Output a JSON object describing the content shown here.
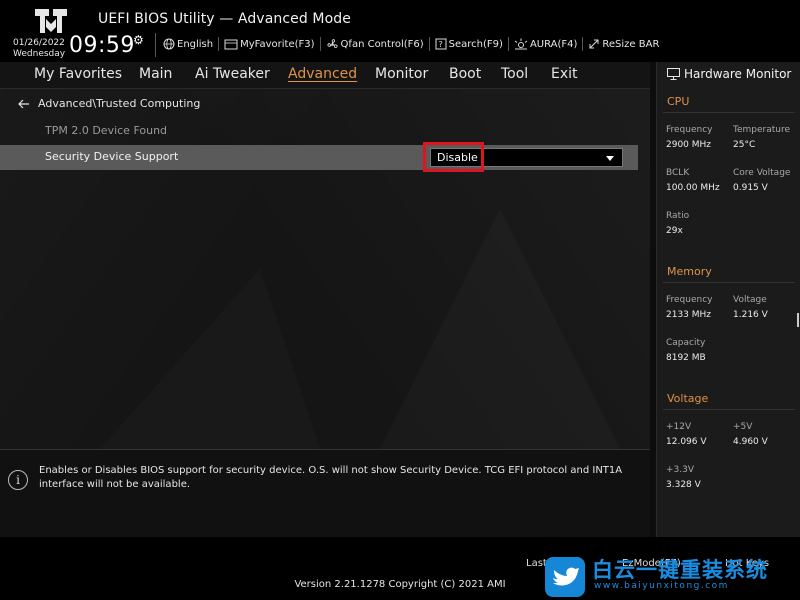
{
  "header": {
    "title": "UEFI BIOS Utility — Advanced Mode",
    "date": "01/26/2022",
    "day": "Wednesday",
    "time": "09:59",
    "toolbar": [
      {
        "icon": "globe-icon",
        "label": "English"
      },
      {
        "icon": "favorite-icon",
        "label": "MyFavorite(F3)"
      },
      {
        "icon": "fan-icon",
        "label": "Qfan Control(F6)"
      },
      {
        "icon": "search-icon",
        "label": "Search(F9)"
      },
      {
        "icon": "aura-icon",
        "label": "AURA(F4)"
      },
      {
        "icon": "resize-icon",
        "label": "ReSize BAR"
      }
    ]
  },
  "menu": {
    "items": [
      "My Favorites",
      "Main",
      "Ai Tweaker",
      "Advanced",
      "Monitor",
      "Boot",
      "Tool",
      "Exit"
    ],
    "active": "Advanced"
  },
  "main": {
    "breadcrumb": "Advanced\\Trusted Computing",
    "tpm_label": "TPM 2.0 Device Found",
    "security_label": "Security Device Support",
    "security_value": "Disable"
  },
  "help": {
    "text": "Enables or Disables BIOS support for security device. O.S. will not show Security Device. TCG EFI protocol and INT1A interface will not be available."
  },
  "hw_monitor": {
    "title": "Hardware Monitor",
    "cpu": {
      "heading": "CPU",
      "frequency_label": "Frequency",
      "frequency_value": "2900 MHz",
      "temperature_label": "Temperature",
      "temperature_value": "25°C",
      "bclk_label": "BCLK",
      "bclk_value": "100.00 MHz",
      "core_voltage_label": "Core Voltage",
      "core_voltage_value": "0.915 V",
      "ratio_label": "Ratio",
      "ratio_value": "29x"
    },
    "memory": {
      "heading": "Memory",
      "frequency_label": "Frequency",
      "frequency_value": "2133 MHz",
      "voltage_label": "Voltage",
      "voltage_value": "1.216 V",
      "capacity_label": "Capacity",
      "capacity_value": "8192 MB"
    },
    "voltage": {
      "heading": "Voltage",
      "v12_label": "+12V",
      "v12_value": "12.096 V",
      "v5_label": "+5V",
      "v5_value": "4.960 V",
      "v33_label": "+3.3V",
      "v33_value": "3.328 V"
    }
  },
  "footer": {
    "last_modified": "Last",
    "ezmode": "EzMode(F7)",
    "hotkeys": "Hot Keys",
    "copyright": "Version 2.21.1278 Copyright (C) 2021 AMI"
  },
  "watermark": {
    "text": "白云一键重装系统",
    "url": "www.baiyunxitong.com"
  },
  "colors": {
    "accent": "#e0924a",
    "highlight_box": "#e0141e",
    "selected_row": "#5a5a5a"
  }
}
